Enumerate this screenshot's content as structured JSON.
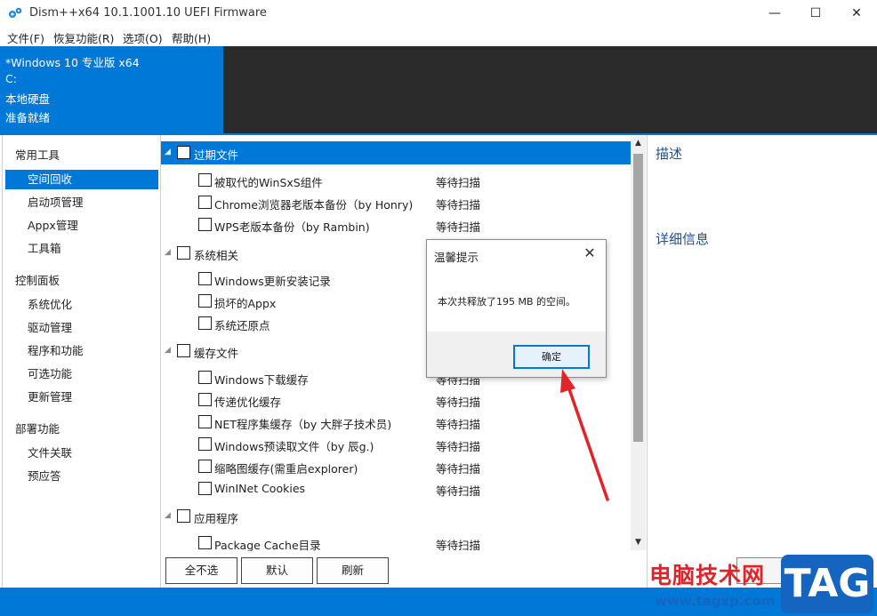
{
  "window": {
    "title": "Dism++x64 10.1.1001.10 UEFI Firmware",
    "controls": {
      "minimize": "—",
      "maximize": "☐",
      "close": "✕"
    }
  },
  "menu": [
    "文件(F)",
    "恢复功能(R)",
    "选项(O)",
    "帮助(H)"
  ],
  "header": {
    "os": "*Windows 10 专业版 x64",
    "drive": "C:",
    "disk_type": "本地硬盘",
    "status": "准备就绪"
  },
  "nav": {
    "groups": [
      {
        "label": "常用工具",
        "items": [
          "空间回收",
          "启动项管理",
          "Appx管理",
          "工具箱"
        ]
      },
      {
        "label": "控制面板",
        "items": [
          "系统优化",
          "驱动管理",
          "程序和功能",
          "可选功能",
          "更新管理"
        ]
      },
      {
        "label": "部署功能",
        "items": [
          "文件关联",
          "预应答"
        ]
      }
    ],
    "active": "空间回收"
  },
  "tree": {
    "groups": [
      {
        "label": "过期文件",
        "items": [
          {
            "label": "被取代的WinSxS组件",
            "status": "等待扫描"
          },
          {
            "label": "Chrome浏览器老版本备份（by Honry)",
            "status": "等待扫描"
          },
          {
            "label": "WPS老版本备份（by Rambin)",
            "status": "等待扫描"
          }
        ]
      },
      {
        "label": "系统相关",
        "items": [
          {
            "label": "Windows更新安装记录",
            "status": ""
          },
          {
            "label": "损坏的Appx",
            "status": ""
          },
          {
            "label": "系统还原点",
            "status": ""
          }
        ]
      },
      {
        "label": "缓存文件",
        "items": [
          {
            "label": "Windows下载缓存",
            "status": "等待扫描"
          },
          {
            "label": "传递优化缓存",
            "status": "等待扫描"
          },
          {
            "label": "NET程序集缓存（by 大胖子技术员)",
            "status": "等待扫描"
          },
          {
            "label": "Windows预读取文件（by 辰g.)",
            "status": "等待扫描"
          },
          {
            "label": "缩略图缓存(需重启explorer)",
            "status": "等待扫描"
          },
          {
            "label": "WinINet Cookies",
            "status": "等待扫描"
          }
        ]
      },
      {
        "label": "应用程序",
        "items": [
          {
            "label": "Package Cache目录",
            "status": "等待扫描"
          }
        ]
      }
    ]
  },
  "buttons": {
    "deselect_all": "全不选",
    "default": "默认",
    "refresh": "刷新"
  },
  "right_panel": {
    "description": "描述",
    "details": "详细信息"
  },
  "dialog": {
    "title": "温馨提示",
    "message": "本次共释放了195 MB 的空间。",
    "ok": "确定"
  },
  "watermark": {
    "text": "电脑技术网",
    "tag": "TAG",
    "url": "www.tagxp.com"
  },
  "colors": {
    "accent": "#0078d7",
    "header_dark": "#2b2b2b",
    "arrow": "#e0242a"
  }
}
